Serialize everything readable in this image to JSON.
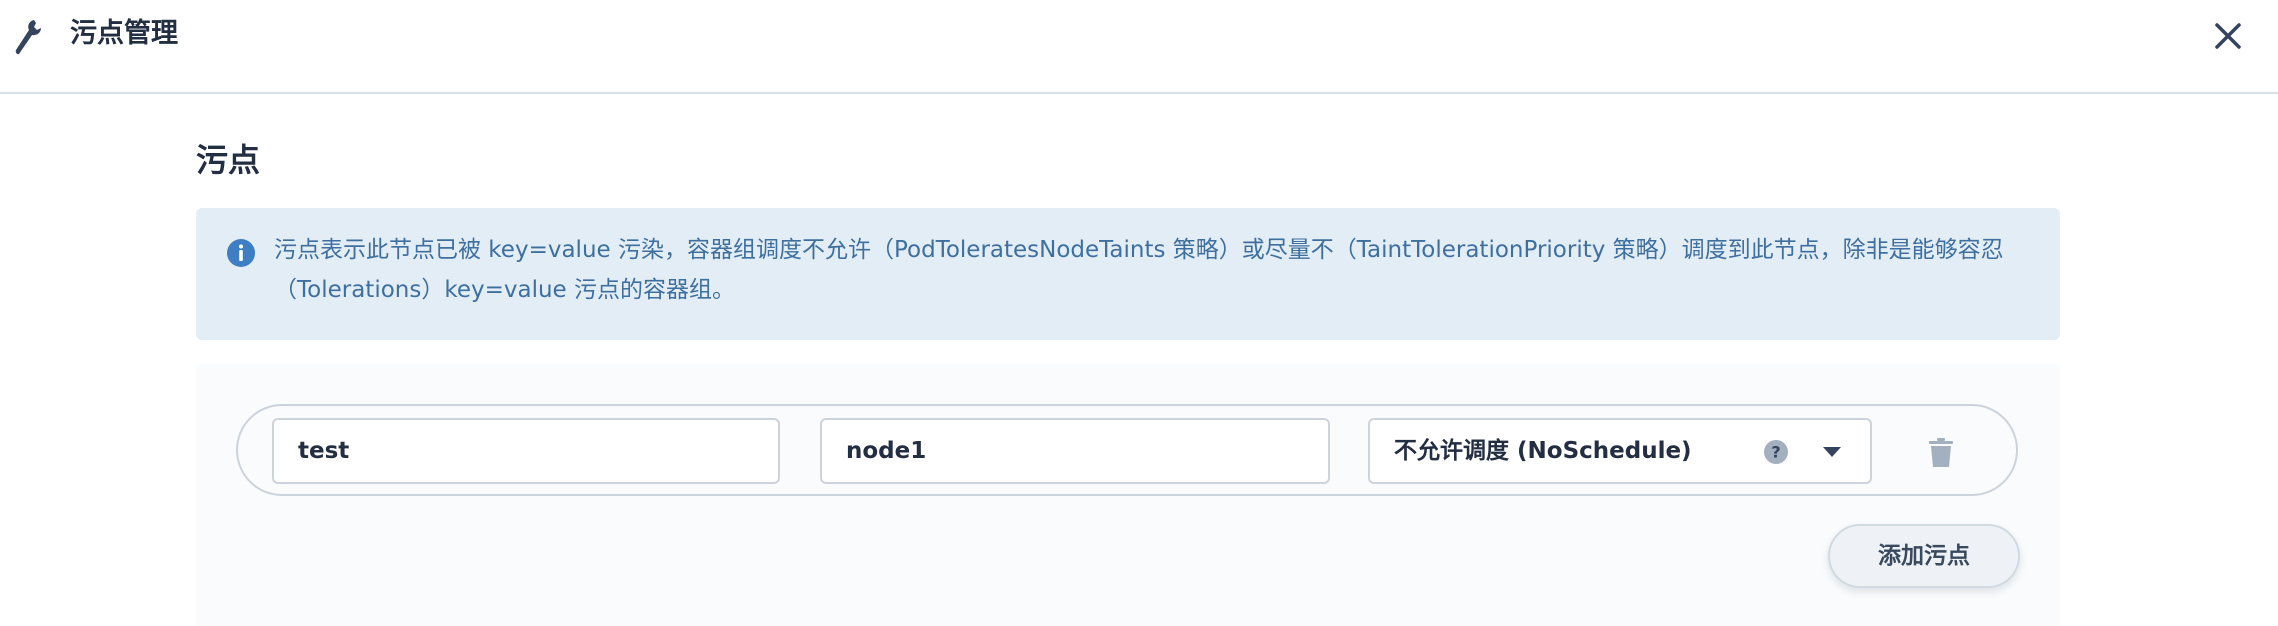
{
  "header": {
    "title": "污点管理",
    "icon": "wrench-icon",
    "close_icon": "close-icon"
  },
  "section": {
    "title": "污点"
  },
  "info": {
    "icon": "info-icon",
    "text": "污点表示此节点已被 key=value 污染，容器组调度不允许（PodToleratesNodeTaints 策略）或尽量不（TaintTolerationPriority 策略）调度到此节点，除非是能够容忍（Tolerations）key=value 污点的容器组。"
  },
  "taints": [
    {
      "key": "test",
      "value": "node1",
      "effect": "不允许调度 (NoSchedule)"
    }
  ],
  "add_button": "添加污点",
  "colors": {
    "info_bg": "#e3edf5",
    "info_text": "#3e6f9f",
    "panel_bg": "#f9fbfd",
    "border": "#ccd3db",
    "title_text": "#242e42"
  }
}
